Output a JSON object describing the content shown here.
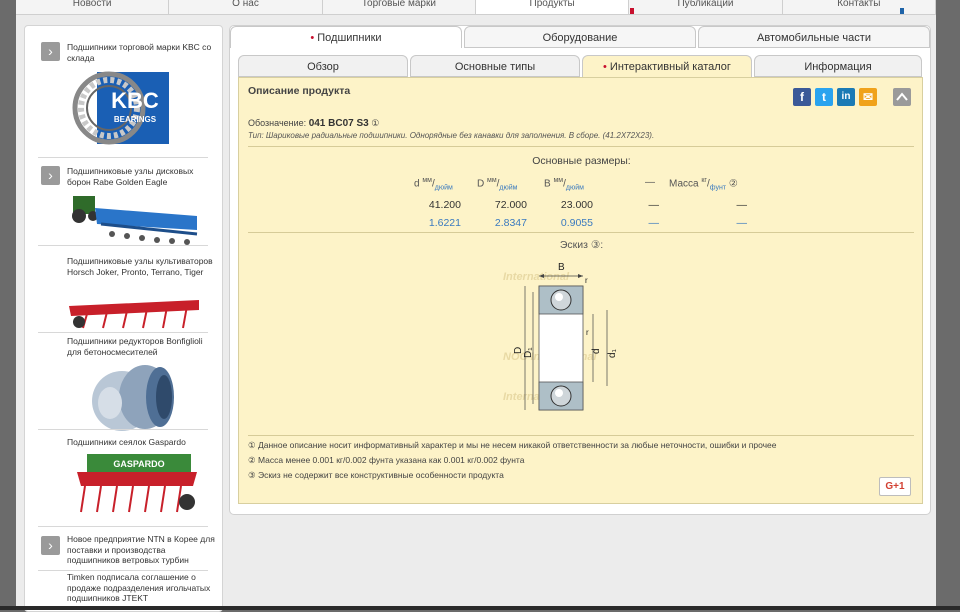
{
  "top_nav": {
    "items": [
      {
        "label": "Новости"
      },
      {
        "label": "О нас"
      },
      {
        "label": "Торговые марки"
      },
      {
        "label": "Продукты"
      },
      {
        "label": "Публикации"
      },
      {
        "label": "Контакты"
      }
    ]
  },
  "sidebar": {
    "items": [
      {
        "title": "Подшипники торговой марки KBC со склада",
        "logo_text": "KBC",
        "logo_subtext": "BEARINGS"
      },
      {
        "title": "Подшипниковые узлы дисковых борон Rabe Golden Eagle"
      },
      {
        "title": "Подшипниковые узлы культиваторов Horsch Joker, Pronto, Terrano, Tiger"
      },
      {
        "title": "Подшипники редукторов Bonfiglioli для бетоносмесителей"
      },
      {
        "title": "Подшипники сеялок Gaspardo",
        "image_text": "GASPARDO"
      },
      {
        "title": "Новое предприятие NTN в Корее для поставки и производства подшипников ветровых турбин"
      },
      {
        "title": "Timken подписала соглашение о продаже подразделения игольчатых подшипников JTEKT"
      }
    ]
  },
  "main_tabs": [
    {
      "label": "Подшипники",
      "active": true
    },
    {
      "label": "Оборудование",
      "active": false
    },
    {
      "label": "Автомобильные части",
      "active": false
    }
  ],
  "sub_tabs": [
    {
      "label": "Обзор",
      "active": false
    },
    {
      "label": "Основные типы",
      "active": false
    },
    {
      "label": "Интерактивный каталог",
      "active": true
    },
    {
      "label": "Информация",
      "active": false
    }
  ],
  "product": {
    "section_title": "Описание продукта",
    "designation_label": "Обозначение:",
    "designation": "041 BC07 S3",
    "designation_note": "①",
    "type_line": "Тип: Шариковые радиальные подшипники. Однорядные без канавки для заполнения. В сборе. (41.2X72X23).",
    "dims_title": "Основные размеры:",
    "headers": {
      "d": "d",
      "d_sup": "мм",
      "d_sub": "дюйм",
      "D": "D",
      "D_sup": "мм",
      "D_sub": "дюйм",
      "B": "B",
      "B_sup": "мм",
      "B_sub": "дюйм",
      "dash": "—",
      "mass": "Масса",
      "mass_sup": "кг",
      "mass_sub": "фунт",
      "mass_note": "②"
    },
    "rows": [
      {
        "d": "41.200",
        "D": "72.000",
        "B": "23.000",
        "c4": "—",
        "mass": "—"
      },
      {
        "d": "1.6221",
        "D": "2.8347",
        "B": "0.9055",
        "c4": "—",
        "mass": "—"
      }
    ],
    "sketch_title": "Эскиз ③:",
    "sketch_labels": {
      "B": "B",
      "r1": "r",
      "r2": "r",
      "D": "D",
      "D1": "D₁",
      "d": "d",
      "d1": "d₁"
    },
    "watermark": [
      "International",
      "NOC International",
      "International"
    ],
    "notes": [
      "① Данное описание носит информативный характер и мы не несем никакой ответственности за любые неточности, ошибки и прочее",
      "② Масса менее 0.001 кг/0.002 фунта указана как 0.001 кг/0.002 фунта",
      "③ Эскиз не содержит все конструктивные особенности продукта"
    ],
    "social": [
      {
        "icon": "facebook-icon",
        "glyph": "f",
        "color": "#3b5998"
      },
      {
        "icon": "twitter-icon",
        "glyph": "t",
        "color": "#2aa3ef"
      },
      {
        "icon": "linkedin-icon",
        "glyph": "in",
        "color": "#1b7ab5"
      },
      {
        "icon": "mail-icon",
        "glyph": "✉",
        "color": "#f0a21b"
      }
    ],
    "gplus_label": "G+1"
  }
}
